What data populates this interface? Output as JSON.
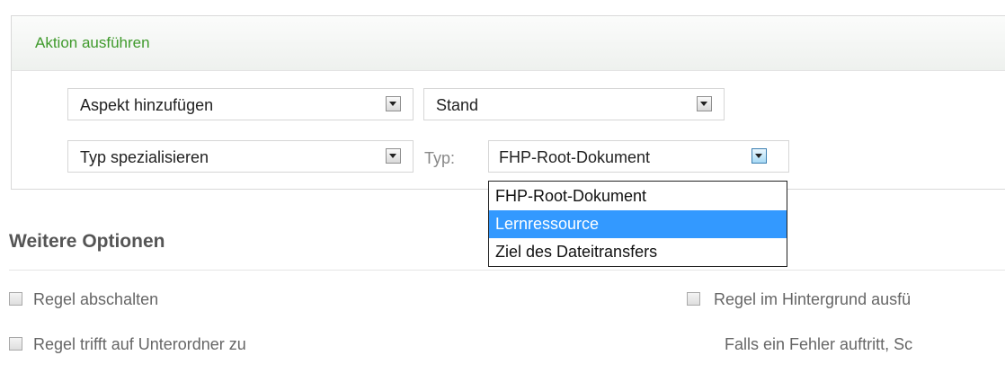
{
  "panel": {
    "title": "Aktion ausführen",
    "rows": [
      {
        "action": "Aspekt hinzufügen",
        "value": "Stand"
      },
      {
        "action": "Typ spezialisieren",
        "value_label": "Typ:",
        "value": "FHP-Root-Dokument"
      }
    ],
    "type_dropdown": {
      "options": [
        "FHP-Root-Dokument",
        "Lernressource",
        "Ziel des Dateitransfers"
      ],
      "highlighted": "Lernressource"
    }
  },
  "options_section": {
    "title": "Weitere Optionen",
    "checkboxes": [
      {
        "label": "Regel abschalten",
        "checked": false
      },
      {
        "label": "Regel trifft auf Unterordner zu",
        "checked": false
      },
      {
        "label": "Regel im Hintergrund ausfü",
        "checked": false
      }
    ],
    "error_text": "Falls ein Fehler auftritt, Sc"
  },
  "colors": {
    "title_green": "#3f9a2c",
    "selection_blue": "#3399ff"
  }
}
